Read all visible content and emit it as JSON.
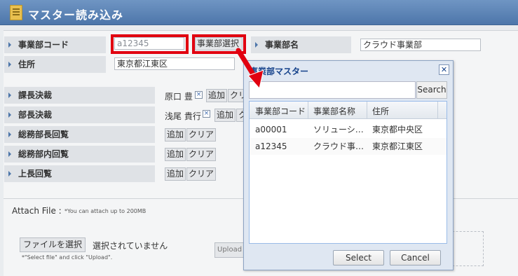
{
  "window": {
    "title": "マスター読み込み"
  },
  "form": {
    "dept_code_label": "事業部コード",
    "dept_code_value": "a12345",
    "dept_select_button": "事業部選択",
    "dept_name_label": "事業部名",
    "dept_name_value": "クラウド事業部",
    "address_label": "住所",
    "address_value": "東京都江東区",
    "approvals": [
      {
        "label": "課長決裁",
        "person": "原口 豊",
        "add": "追加",
        "clear": "クリ"
      },
      {
        "label": "部長決裁",
        "person": "浅尾 貴行",
        "add": "追加",
        "clear": "ク"
      },
      {
        "label": "総務部長回覧",
        "person": "",
        "add": "追加",
        "clear": "クリア"
      },
      {
        "label": "総務部内回覧",
        "person": "",
        "add": "追加",
        "clear": "クリア"
      },
      {
        "label": "上長回覧",
        "person": "",
        "add": "追加",
        "clear": "クリア"
      }
    ]
  },
  "attach": {
    "title": "Attach File :",
    "note": "*You can attach up to 200MB",
    "choose_button": "ファイルを選択",
    "no_file_text": "選択されていません",
    "hint": "*\"Select file\" and click \"Upload\".",
    "upload_button": "Upload"
  },
  "dialog": {
    "title": "事業部マスター",
    "close_glyph": "✕",
    "search_placeholder": "",
    "search_button": "Search",
    "columns": [
      "事業部コード",
      "事業部名称",
      "住所"
    ],
    "rows": [
      [
        "a00001",
        "ソリューシ…",
        "東京都中央区"
      ],
      [
        "a12345",
        "クラウド事…",
        "東京都江東区"
      ]
    ],
    "select_button": "Select",
    "cancel_button": "Cancel"
  },
  "colors": {
    "highlight": "#e10010",
    "title_bar": "#4d76aa"
  }
}
